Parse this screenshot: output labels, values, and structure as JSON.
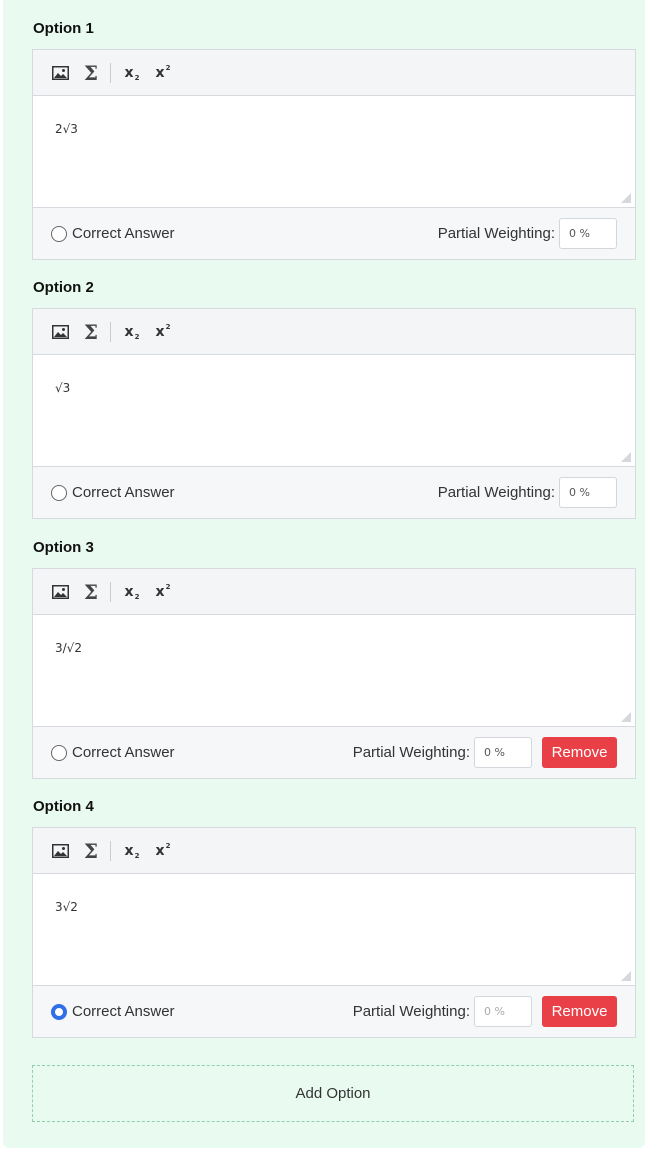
{
  "options": [
    {
      "title": "Option 1",
      "content": "2√3",
      "correct_label": "Correct Answer",
      "correct": false,
      "pw_label": "Partial Weighting:",
      "pw_value": "0 %",
      "remove_label": ""
    },
    {
      "title": "Option 2",
      "content": "√3",
      "correct_label": "Correct Answer",
      "correct": false,
      "pw_label": "Partial Weighting:",
      "pw_value": "0 %",
      "remove_label": ""
    },
    {
      "title": "Option 3",
      "content": "3/√2",
      "correct_label": "Correct Answer",
      "correct": false,
      "pw_label": "Partial Weighting:",
      "pw_value": "0 %",
      "remove_label": "Remove"
    },
    {
      "title": "Option 4",
      "content": "3√2",
      "correct_label": "Correct Answer",
      "correct": true,
      "pw_label": "Partial Weighting:",
      "pw_value": "0 %",
      "remove_label": "Remove"
    }
  ],
  "toolbar_icons": [
    "image-icon",
    "sigma-icon",
    "subscript-icon",
    "superscript-icon"
  ],
  "add_option_label": "Add Option",
  "colors": {
    "panel_bg": "#e9fbf1",
    "accent": "#2f6fe8",
    "danger": "#e84046"
  }
}
